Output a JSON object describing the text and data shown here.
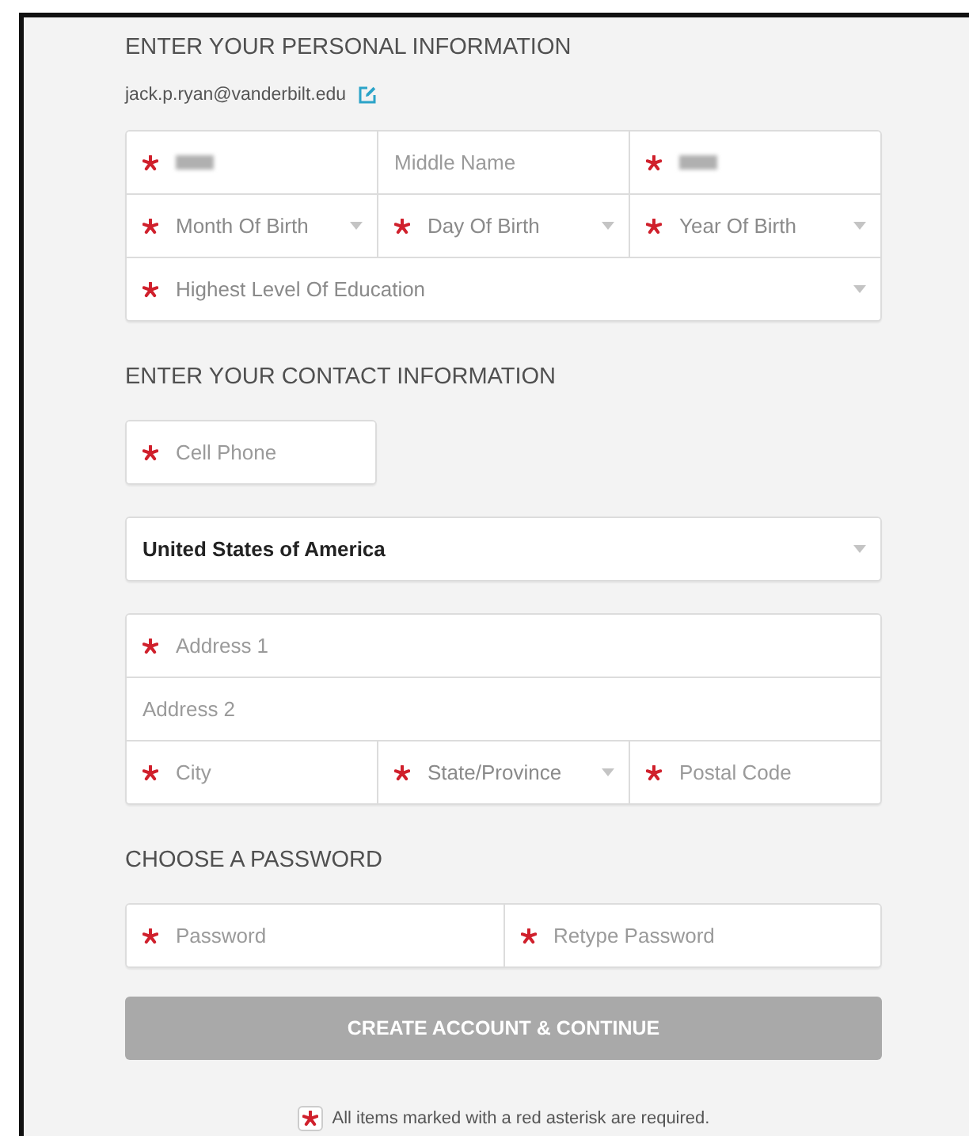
{
  "sections": [
    {
      "heading": "ENTER YOUR PERSONAL INFORMATION",
      "email": "jack.p.ryan@vanderbilt.edu",
      "groups": [
        {
          "kind": "full",
          "rows": [
            [
              {
                "kind": "redacted",
                "required": true
              },
              {
                "kind": "text",
                "placeholder": "Middle Name",
                "required": false
              },
              {
                "kind": "redacted",
                "required": true
              }
            ],
            [
              {
                "kind": "select",
                "placeholder": "Month Of Birth",
                "required": true
              },
              {
                "kind": "select",
                "placeholder": "Day Of Birth",
                "required": true
              },
              {
                "kind": "select",
                "placeholder": "Year Of Birth",
                "required": true
              }
            ],
            [
              {
                "kind": "select",
                "placeholder": "Highest Level Of Education",
                "required": true
              }
            ]
          ]
        }
      ]
    },
    {
      "heading": "ENTER YOUR CONTACT INFORMATION",
      "groups": [
        {
          "kind": "short",
          "rows": [
            [
              {
                "kind": "text",
                "placeholder": "Cell Phone",
                "required": true
              }
            ]
          ]
        },
        {
          "kind": "full",
          "rows": [
            [
              {
                "kind": "select",
                "value": "United States of America",
                "required": false
              }
            ]
          ]
        },
        {
          "kind": "full",
          "rows": [
            [
              {
                "kind": "text",
                "placeholder": "Address 1",
                "required": true
              }
            ],
            [
              {
                "kind": "text",
                "placeholder": "Address 2",
                "required": false
              }
            ],
            [
              {
                "kind": "text",
                "placeholder": "City",
                "required": true
              },
              {
                "kind": "select",
                "placeholder": "State/Province",
                "required": true
              },
              {
                "kind": "text",
                "placeholder": "Postal Code",
                "required": true
              }
            ]
          ]
        }
      ]
    },
    {
      "heading": "CHOOSE A PASSWORD",
      "groups": [
        {
          "kind": "full",
          "rows": [
            [
              {
                "kind": "password",
                "placeholder": "Password",
                "required": true
              },
              {
                "kind": "password",
                "placeholder": "Retype Password",
                "required": true
              }
            ]
          ]
        }
      ]
    }
  ],
  "button": {
    "label": "CREATE ACCOUNT & CONTINUE",
    "disabled": true
  },
  "footnote": "All items marked with a red asterisk are required."
}
